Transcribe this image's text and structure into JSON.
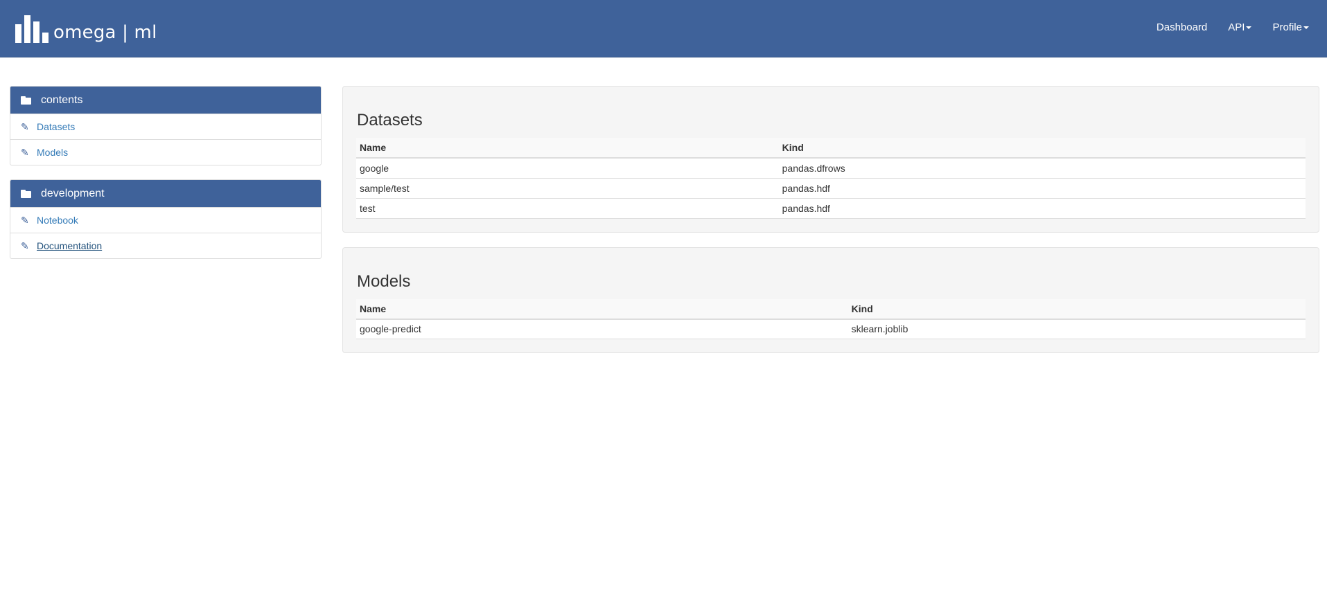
{
  "brand": {
    "text": "omega | ml"
  },
  "nav": {
    "dashboard": "Dashboard",
    "api": "API",
    "profile": "Profile"
  },
  "sidebar": {
    "contents": {
      "title": "contents",
      "items": [
        "Datasets",
        "Models"
      ]
    },
    "development": {
      "title": "development",
      "items": [
        "Notebook",
        "Documentation"
      ]
    }
  },
  "datasets": {
    "title": "Datasets",
    "columns": [
      "Name",
      "Kind"
    ],
    "rows": [
      [
        "google",
        "pandas.dfrows"
      ],
      [
        "sample/test",
        "pandas.hdf"
      ],
      [
        "test",
        "pandas.hdf"
      ]
    ]
  },
  "models": {
    "title": "Models",
    "columns": [
      "Name",
      "Kind"
    ],
    "rows": [
      [
        "google-predict",
        "sklearn.joblib"
      ]
    ]
  },
  "colors": {
    "navbar": "#3f629a",
    "link": "#337ab7",
    "well": "#f5f5f5"
  },
  "icons": {
    "logo": "bar-chart-logo-icon",
    "panel_heading": "folder-icon",
    "panel_item": "pencil-icon",
    "dropdown": "caret-down-icon"
  }
}
